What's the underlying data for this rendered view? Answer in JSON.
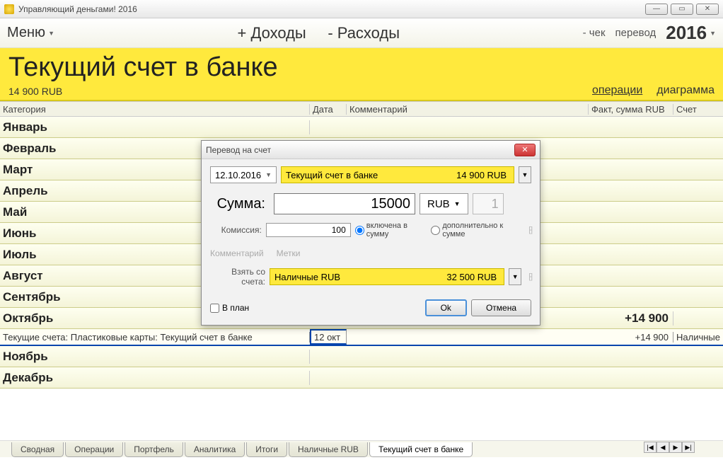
{
  "titlebar": {
    "app_title": "Управляющий деньгами! 2016"
  },
  "toolbar": {
    "menu": "Меню",
    "income": "+ Доходы",
    "expense": "- Расходы",
    "check": "- чек",
    "transfer": "перевод",
    "year": "2016"
  },
  "header": {
    "account_name": "Текущий счет в банке",
    "balance": "14 900 RUB",
    "tab_ops": "операции",
    "tab_chart": "диаграмма"
  },
  "grid": {
    "col_category": "Категория",
    "col_date": "Дата",
    "col_comment": "Комментарий",
    "col_fact": "Факт, сумма RUB",
    "col_account": "Счет",
    "months": [
      "Январь",
      "Февраль",
      "Март",
      "Апрель",
      "Май",
      "Июнь",
      "Июль",
      "Август",
      "Сентябрь",
      "Октябрь",
      "Ноябрь",
      "Декабрь"
    ],
    "oct_fact": "+14 900",
    "detail": {
      "category": "Текущие счета: Пластиковые карты: Текущий счет в банке",
      "date": "12 окт",
      "fact": "+14 900",
      "account": "Наличные"
    }
  },
  "dialog": {
    "title": "Перевод на счет",
    "date": "12.10.2016",
    "to_account": "Текущий счет в банке",
    "to_balance": "14 900 RUB",
    "sum_label": "Сумма:",
    "sum_value": "15000",
    "currency": "RUB",
    "qty": "1",
    "commission_label": "Комиссия:",
    "commission_value": "100",
    "radio_incl": "включена в сумму",
    "radio_add": "дополнительно к сумме",
    "link_comment": "Комментарий",
    "link_tags": "Метки",
    "from_label": "Взять со счета:",
    "from_account": "Наличные RUB",
    "from_balance": "32 500 RUB",
    "checkbox_plan": "В план",
    "btn_ok": "Ok",
    "btn_cancel": "Отмена"
  },
  "tabs": {
    "items": [
      "Сводная",
      "Операции",
      "Портфель",
      "Аналитика",
      "Итоги",
      "Наличные RUB",
      "Текущий счет в банке"
    ]
  }
}
